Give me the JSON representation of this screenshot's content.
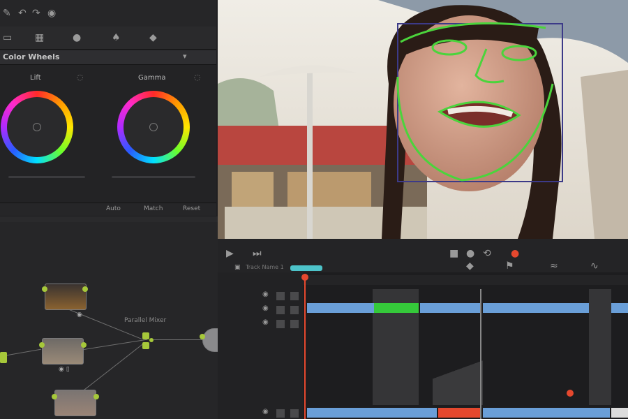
{
  "panels": {
    "color_wheels": {
      "title": "Color Wheels",
      "wheels": [
        {
          "label": "Lift"
        },
        {
          "label": "Gamma"
        }
      ],
      "footer_buttons": [
        "Auto",
        "Match",
        "Reset"
      ]
    },
    "node_editor": {
      "label": "Parallel Mixer"
    },
    "timeline": {
      "track_name": "Track Name 1"
    }
  },
  "colors": {
    "accent_green": "#35c93a",
    "clip_blue": "#6a9fd8",
    "playhead_red": "#e5482e",
    "face_mesh": "#4bd43c",
    "node_port": "#a6c83a"
  },
  "icons": [
    "pen-icon",
    "undo-icon",
    "redo-icon",
    "eye-icon",
    "grid-icon",
    "circle-icon",
    "wand-icon",
    "keyframe-icon",
    "play-icon",
    "stop-icon",
    "skip-icon",
    "flag-icon"
  ]
}
